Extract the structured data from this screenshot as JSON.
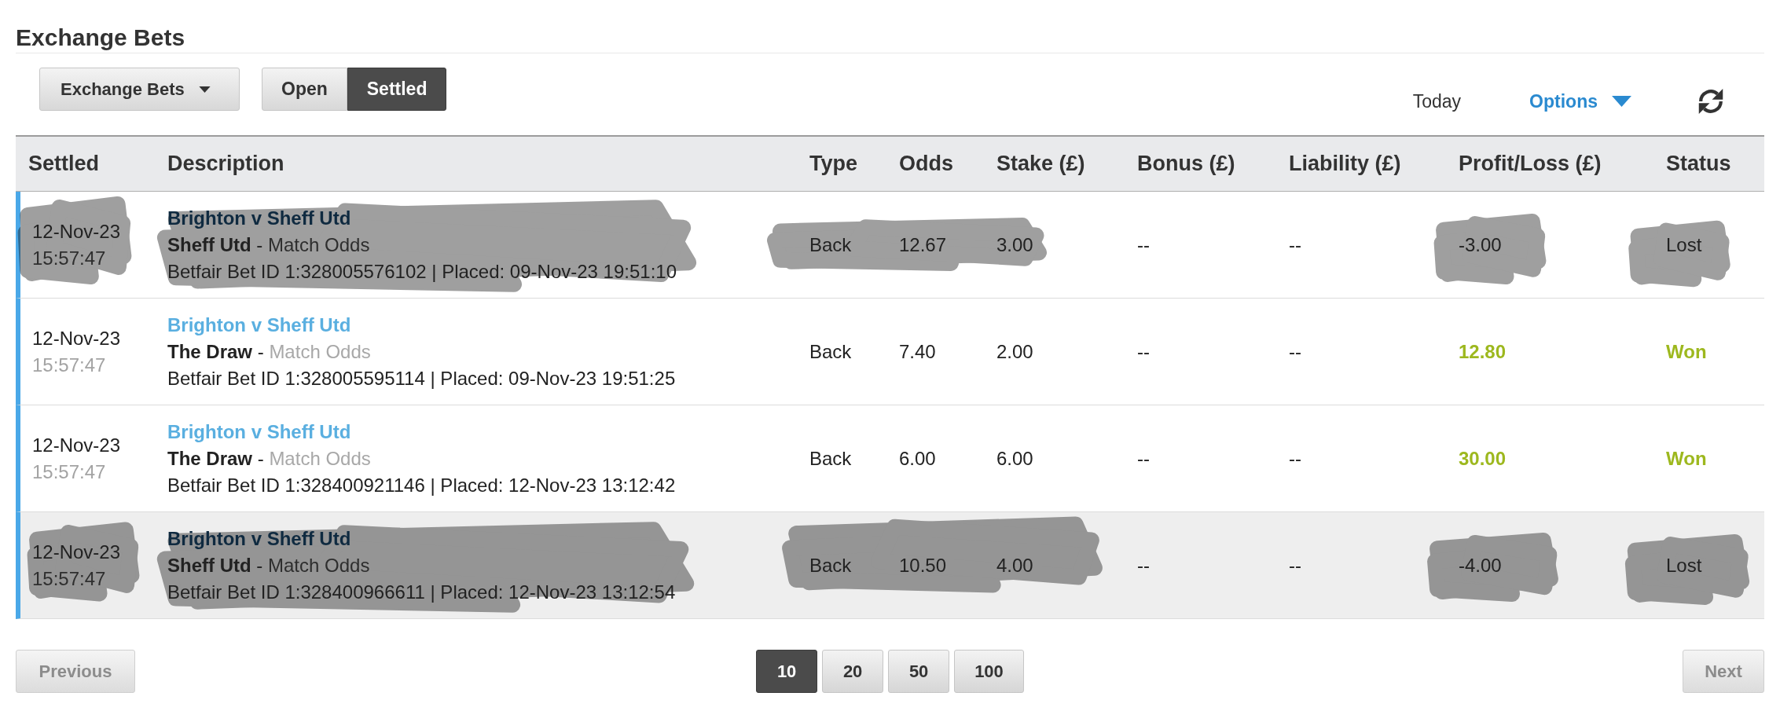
{
  "page": {
    "title": "Exchange Bets"
  },
  "toolbar": {
    "bet_type": {
      "label": "Exchange Bets"
    },
    "status_tabs": [
      {
        "label": "Open",
        "selected": false
      },
      {
        "label": "Settled",
        "selected": true
      }
    ],
    "date_range": "Today",
    "options": {
      "label": "Options"
    }
  },
  "table": {
    "columns": [
      "Settled",
      "Description",
      "Type",
      "Odds",
      "Stake (£)",
      "Bonus (£)",
      "Liability (£)",
      "Profit/Loss (£)",
      "Status"
    ],
    "rows": [
      {
        "kind": "lost",
        "redacted": true,
        "highlighted": false,
        "settled_date": "12-Nov-23",
        "settled_time": "15:57:47",
        "event": "Brighton v Sheff Utd",
        "selection": "Sheff Utd",
        "separator": "-",
        "market": "Match Odds",
        "bet_info": "Betfair Bet ID 1:328005576102 | Placed: 09-Nov-23 19:51:10",
        "type": "Back",
        "odds": "12.67",
        "stake": "3.00",
        "bonus": "--",
        "liability": "--",
        "profit_loss": "-3.00",
        "status": "Lost"
      },
      {
        "kind": "won",
        "redacted": false,
        "highlighted": false,
        "settled_date": "12-Nov-23",
        "settled_time": "15:57:47",
        "event": "Brighton v Sheff Utd",
        "selection": "The Draw",
        "separator": "-",
        "market": "Match Odds",
        "bet_info": "Betfair Bet ID 1:328005595114 | Placed: 09-Nov-23 19:51:25",
        "type": "Back",
        "odds": "7.40",
        "stake": "2.00",
        "bonus": "--",
        "liability": "--",
        "profit_loss": "12.80",
        "status": "Won"
      },
      {
        "kind": "won",
        "redacted": false,
        "highlighted": false,
        "settled_date": "12-Nov-23",
        "settled_time": "15:57:47",
        "event": "Brighton v Sheff Utd",
        "selection": "The Draw",
        "separator": "-",
        "market": "Match Odds",
        "bet_info": "Betfair Bet ID 1:328400921146 | Placed: 12-Nov-23 13:12:42",
        "type": "Back",
        "odds": "6.00",
        "stake": "6.00",
        "bonus": "--",
        "liability": "--",
        "profit_loss": "30.00",
        "status": "Won"
      },
      {
        "kind": "lost",
        "redacted": true,
        "highlighted": true,
        "settled_date": "12-Nov-23",
        "settled_time": "15:57:47",
        "event": "Brighton v Sheff Utd",
        "selection": "Sheff Utd",
        "separator": "-",
        "market": "Match Odds",
        "bet_info": "Betfair Bet ID 1:328400966611 | Placed: 12-Nov-23 13:12:54",
        "type": "Back",
        "odds": "10.50",
        "stake": "4.00",
        "bonus": "--",
        "liability": "--",
        "profit_loss": "-4.00",
        "status": "Lost"
      }
    ]
  },
  "pagination": {
    "previous": {
      "label": "Previous",
      "disabled": true
    },
    "page_sizes": [
      {
        "label": "10",
        "selected": true
      },
      {
        "label": "20",
        "selected": false
      },
      {
        "label": "50",
        "selected": false
      },
      {
        "label": "100",
        "selected": false
      }
    ],
    "next": {
      "label": "Next",
      "disabled": true
    }
  }
}
